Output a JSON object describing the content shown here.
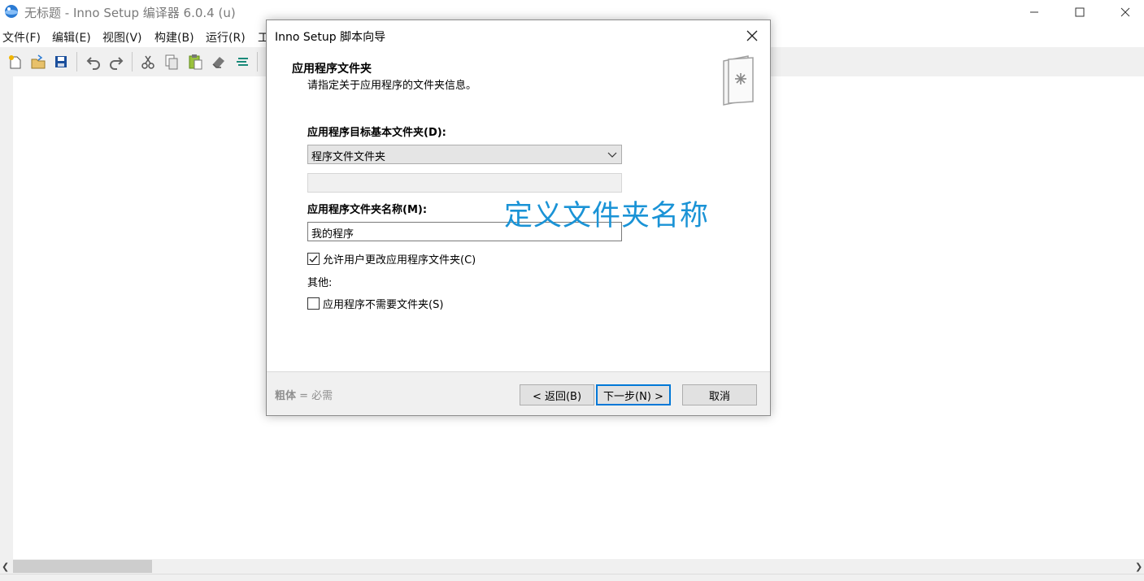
{
  "window": {
    "title": "无标题 - Inno Setup 编译器 6.0.4 (u)",
    "menu": [
      "文件(F)",
      "编辑(E)",
      "视图(V)",
      "构建(B)",
      "运行(R)",
      "工"
    ]
  },
  "toolbar": {
    "buttons": [
      "new-file-icon",
      "open-folder-icon",
      "save-icon",
      "undo-icon",
      "redo-icon",
      "cut-icon",
      "copy-icon",
      "paste-icon",
      "eraser-icon",
      "align-icon"
    ]
  },
  "dialog": {
    "title": "Inno Setup 脚本向导",
    "header_title": "应用程序文件夹",
    "header_subtitle": "请指定关于应用程序的文件夹信息。",
    "dest_base_label": "应用程序目标基本文件夹(D):",
    "dest_base_value": "程序文件文件夹",
    "folder_name_label": "应用程序文件夹名称(M):",
    "folder_name_value": "我的程序",
    "allow_change_label": "允许用户更改应用程序文件夹(C)",
    "allow_change_checked": true,
    "other_label": "其他:",
    "no_folder_label": "应用程序不需要文件夹(S)",
    "no_folder_checked": false,
    "footer_note_bold": "粗体",
    "footer_note_rest": " = 必需",
    "back_button": "< 返回(B)",
    "next_button": "下一步(N) >",
    "cancel_button": "取消"
  },
  "annotation": "定义文件夹名称",
  "colors": {
    "annotation": "#1a93d6",
    "focus_border": "#0078d7",
    "toolbar_bg": "#f0f0f0"
  }
}
